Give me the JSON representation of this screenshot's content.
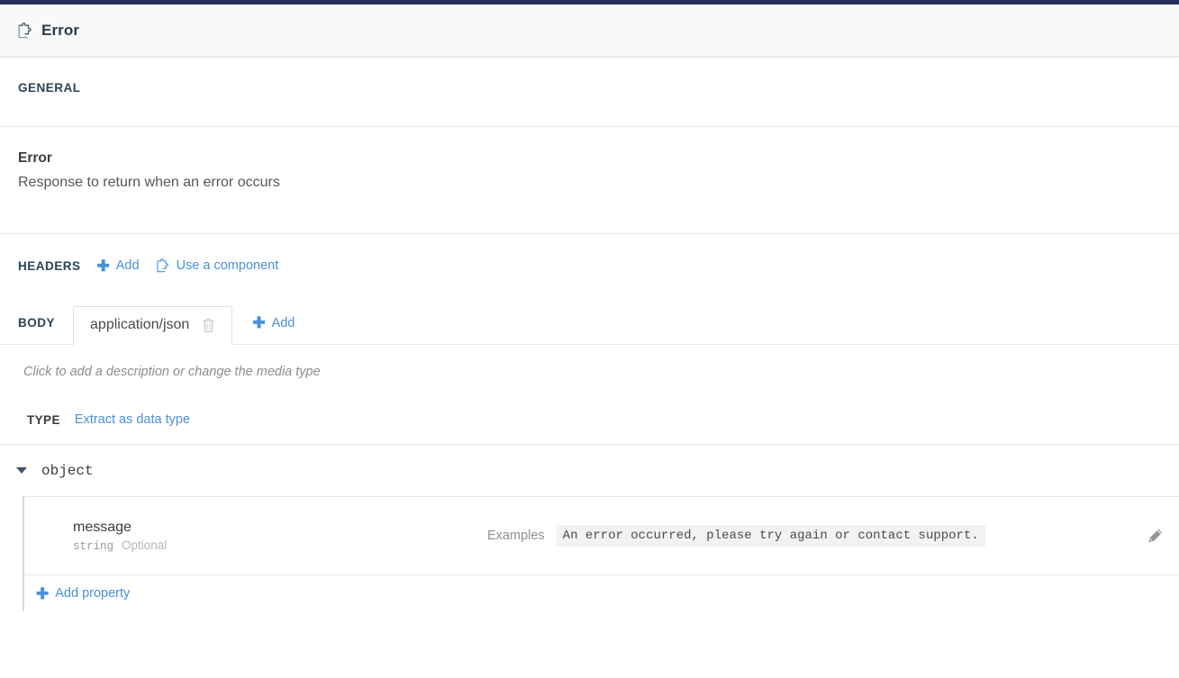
{
  "header": {
    "icon": "component-icon",
    "title": "Error"
  },
  "general": {
    "section_label": "GENERAL",
    "response_name": "Error",
    "response_description": "Response to return when an error occurs"
  },
  "headers": {
    "section_label": "HEADERS",
    "add_label": "Add",
    "use_component_label": "Use a component",
    "use_component_icon": "component-icon",
    "add_icon": "plus-icon"
  },
  "body": {
    "section_label": "BODY",
    "tabs": [
      {
        "label": "application/json",
        "active": true,
        "delete_icon": "trash-icon"
      }
    ],
    "add_label": "Add",
    "add_icon": "plus-icon",
    "media_description_placeholder": "Click to add a description or change the media type"
  },
  "type": {
    "label": "TYPE",
    "extract_link": "Extract as data type",
    "root": {
      "name": "object",
      "expanded": true,
      "caret_icon": "chevron-down-icon"
    },
    "properties": [
      {
        "name": "message",
        "type": "string",
        "required_label": "Optional",
        "examples_label": "Examples",
        "example_value": "An error occurred, please try again or contact support.",
        "edit_icon": "pencil-icon"
      }
    ],
    "add_property_label": "Add property",
    "add_property_icon": "plus-icon"
  },
  "colors": {
    "accent_link": "#4a90d9",
    "top_strip": "#25305c",
    "section_heading": "#2d4356",
    "header_bg": "#f9f9f9",
    "divider": "#e8e8e8",
    "chip_bg": "#f2f2f2"
  }
}
